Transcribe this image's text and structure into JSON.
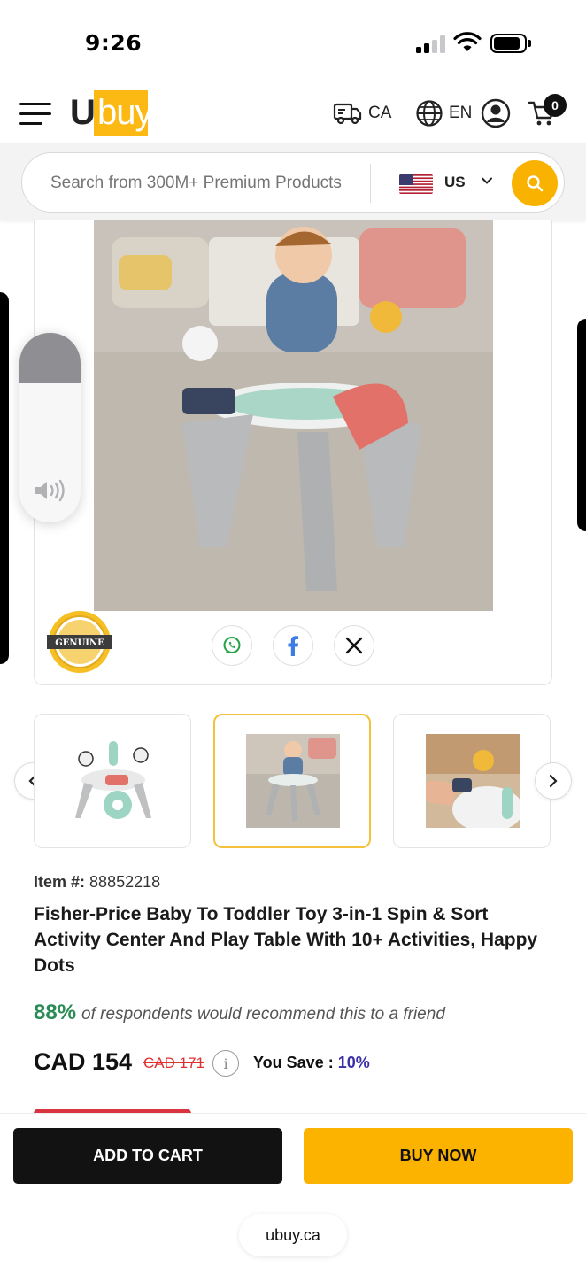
{
  "status_bar": {
    "time": "9:26"
  },
  "header": {
    "logo_u": "U",
    "logo_buy": "buy",
    "delivery_country": "CA",
    "language": "EN",
    "cart_count": "0"
  },
  "search": {
    "placeholder": "Search from 300M+ Premium Products",
    "country": "US"
  },
  "product": {
    "genuine_label": "GENUINE",
    "item_label": "Item #:",
    "item_number": "88852218",
    "title": "Fisher-Price Baby To Toddler Toy 3-in-1 Spin & Sort Activity Center And Play Table With 10+ Activities, Happy Dots",
    "recommend_pct": "88%",
    "recommend_text": "of respondents would recommend this to a friend",
    "price": "CAD 154",
    "old_price": "CAD 171",
    "info_glyph": "i",
    "you_save_label": "You Save :",
    "you_save_pct": "10%",
    "share_icons": [
      "whatsapp-icon",
      "facebook-icon",
      "x-icon"
    ],
    "thumbnails_active_index": 1
  },
  "volume": {
    "level": 0.26
  },
  "bottom_bar": {
    "add_to_cart": "ADD TO CART",
    "buy_now": "BUY NOW",
    "url": "ubuy.ca"
  },
  "colors": {
    "brand_yellow": "#fdb913",
    "buy_button": "#fbb300",
    "cart_button": "#121212",
    "recommend_green": "#2a8b57",
    "old_price_red": "#e03131",
    "save_purple": "#3b2fa8"
  }
}
